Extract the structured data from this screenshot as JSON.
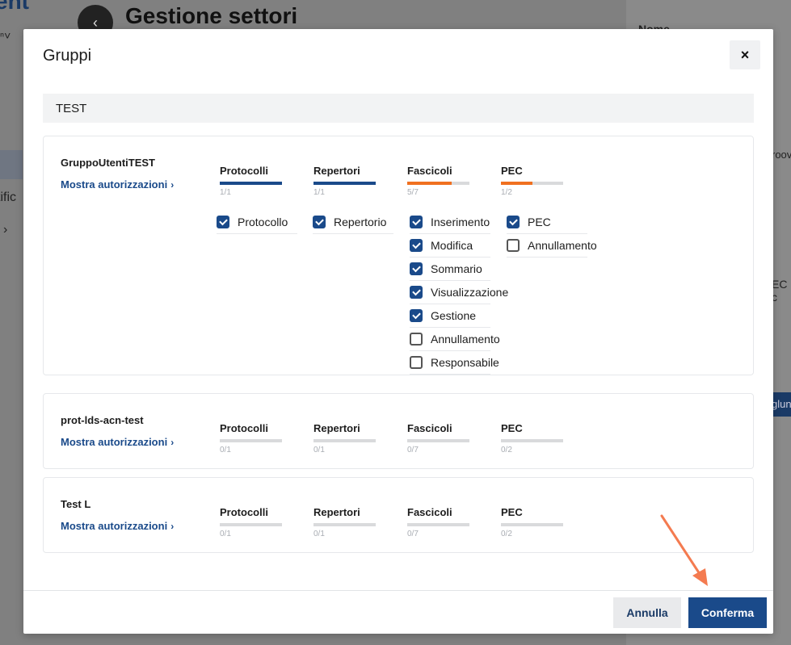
{
  "background": {
    "brand_fragment": "ent",
    "page_title": "Gestione settori",
    "sidebar_fragment": "tific",
    "right_panel": {
      "nome": "Nome",
      "proov": "roov",
      "pec": "EC c",
      "button": "glun"
    }
  },
  "modal": {
    "title": "Gruppi",
    "close_label": "×",
    "search_value": "TEST",
    "show_auth_label": "Mostra autorizzazioni",
    "groups": [
      {
        "name": "GruppoUtentiTEST",
        "categories": [
          {
            "label": "Protocolli",
            "count": "1/1",
            "progress": 1.0,
            "color": "#1a4a8a"
          },
          {
            "label": "Repertori",
            "count": "1/1",
            "progress": 1.0,
            "color": "#1a4a8a"
          },
          {
            "label": "Fascicoli",
            "count": "5/7",
            "progress": 0.714,
            "color": "#f07020"
          },
          {
            "label": "PEC",
            "count": "1/2",
            "progress": 0.5,
            "color": "#f07020"
          }
        ],
        "permissions": {
          "protocolli": [
            {
              "label": "Protocollo",
              "checked": true
            }
          ],
          "repertori": [
            {
              "label": "Repertorio",
              "checked": true
            }
          ],
          "fascicoli": [
            {
              "label": "Inserimento",
              "checked": true
            },
            {
              "label": "Modifica",
              "checked": true
            },
            {
              "label": "Sommario",
              "checked": true
            },
            {
              "label": "Visualizzazione",
              "checked": true
            },
            {
              "label": "Gestione",
              "checked": true
            },
            {
              "label": "Annullamento",
              "checked": false
            },
            {
              "label": "Responsabile",
              "checked": false
            }
          ],
          "pec": [
            {
              "label": "PEC",
              "checked": true
            },
            {
              "label": "Annullamento",
              "checked": false
            }
          ]
        }
      },
      {
        "name": "prot-lds-acn-test",
        "categories": [
          {
            "label": "Protocolli",
            "count": "0/1",
            "progress": 0,
            "color": "#1a4a8a"
          },
          {
            "label": "Repertori",
            "count": "0/1",
            "progress": 0,
            "color": "#1a4a8a"
          },
          {
            "label": "Fascicoli",
            "count": "0/7",
            "progress": 0,
            "color": "#f07020"
          },
          {
            "label": "PEC",
            "count": "0/2",
            "progress": 0,
            "color": "#f07020"
          }
        ]
      },
      {
        "name": "Test L",
        "categories": [
          {
            "label": "Protocolli",
            "count": "0/1",
            "progress": 0,
            "color": "#1a4a8a"
          },
          {
            "label": "Repertori",
            "count": "0/1",
            "progress": 0,
            "color": "#1a4a8a"
          },
          {
            "label": "Fascicoli",
            "count": "0/7",
            "progress": 0,
            "color": "#f07020"
          },
          {
            "label": "PEC",
            "count": "0/2",
            "progress": 0,
            "color": "#f07020"
          }
        ]
      }
    ],
    "footer": {
      "cancel_label": "Annulla",
      "confirm_label": "Conferma"
    }
  },
  "colors": {
    "primary": "#1a4a8a",
    "accent": "#f07020",
    "annotation_arrow": "#f47b50"
  }
}
